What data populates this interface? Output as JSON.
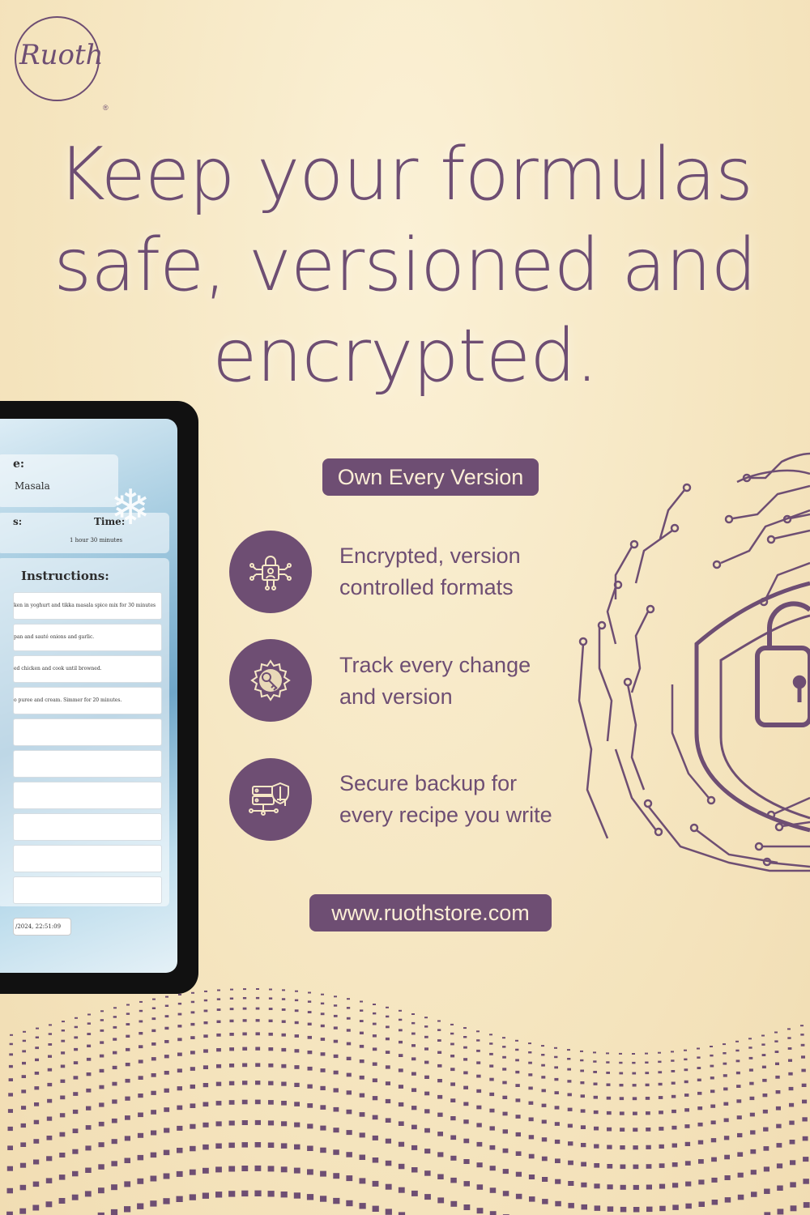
{
  "brand": {
    "logo_text": "Ruoth",
    "reg_mark": "®"
  },
  "headline": {
    "line1": "Keep your formulas",
    "line2": "safe, versioned and",
    "line3": "encrypted."
  },
  "badge": {
    "label": "Own Every Version"
  },
  "features": [
    {
      "icon": "encrypted-lock-circuit-icon",
      "line1": "Encrypted, version",
      "line2": "controlled formats"
    },
    {
      "icon": "gear-key-icon",
      "line1": "Track every change",
      "line2": "and version"
    },
    {
      "icon": "server-shield-icon",
      "line1": "Secure backup for",
      "line2": "every recipe you write"
    }
  ],
  "website": {
    "label": "www.ruothstore.com"
  },
  "tablet": {
    "name_label": "e:",
    "name_value": "Masala",
    "servings_label": "s:",
    "time_label": "Time:",
    "time_value": "1 hour 30 minutes",
    "instructions_title": "Instructions:",
    "steps": [
      "ken in yoghurt and tikka masala spice mix for 30 minutes",
      "pan and sauté onions and garlic.",
      "ed chicken and cook until browned.",
      "o puree and cream. Simmer for 20 minutes.",
      "",
      "",
      "",
      "",
      "",
      ""
    ],
    "timestamp": "/2024, 22:51:09"
  },
  "colors": {
    "accent": "#6e4e73",
    "background": "#f6e8c6",
    "pill_text": "#fbeed6"
  }
}
